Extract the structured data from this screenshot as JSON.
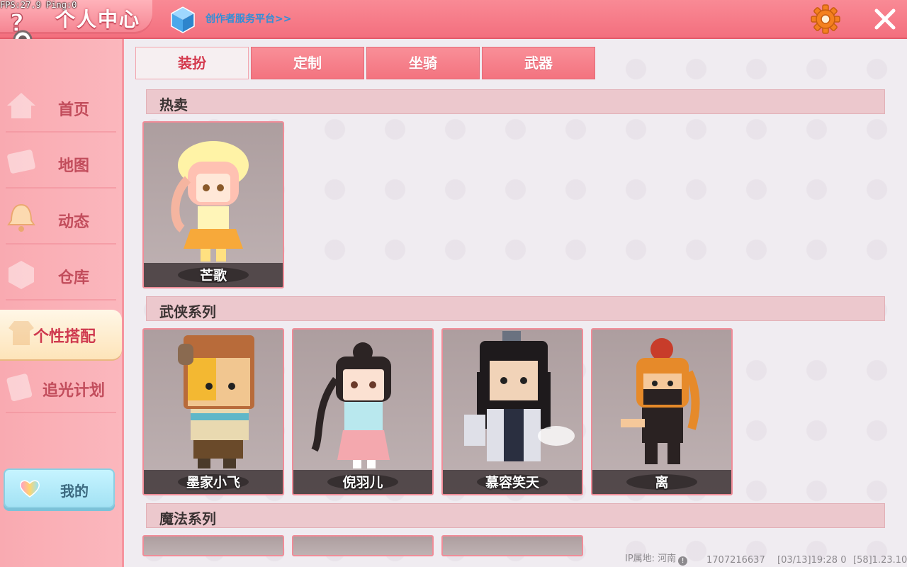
{
  "debug": {
    "fps_text": "FPS:27.9  Ping:0"
  },
  "header": {
    "title": "个人中心",
    "creator_link": "创作者服务平台>>"
  },
  "sidebar": {
    "items": [
      {
        "label": "首页",
        "icon": "house-icon"
      },
      {
        "label": "地图",
        "icon": "map-icon"
      },
      {
        "label": "动态",
        "icon": "bell-icon"
      },
      {
        "label": "仓库",
        "icon": "box-icon"
      },
      {
        "label": "个性搭配",
        "icon": "outfit-icon",
        "active": true
      },
      {
        "label": "追光计划",
        "icon": "star-card-icon"
      }
    ],
    "my_button": "我的"
  },
  "tabs": [
    {
      "label": "装扮",
      "active": true
    },
    {
      "label": "定制"
    },
    {
      "label": "坐骑"
    },
    {
      "label": "武器"
    }
  ],
  "sections": [
    {
      "title": "热卖",
      "items": [
        {
          "name": "芒歌"
        }
      ]
    },
    {
      "title": "武侠系列",
      "items": [
        {
          "name": "墨家小飞"
        },
        {
          "name": "倪羽儿"
        },
        {
          "name": "慕容笑天"
        },
        {
          "name": "离"
        }
      ]
    },
    {
      "title": "魔法系列",
      "items": []
    }
  ],
  "footer": {
    "ip_label": "IP属地: 河南",
    "uid": "1707216637",
    "timestamp": "[03/13]19:28 0",
    "version": "[58]1.23.10"
  },
  "colors": {
    "accent": "#f36f7e",
    "active_tab_text": "#d43a4e",
    "card_border": "#f08c98"
  }
}
